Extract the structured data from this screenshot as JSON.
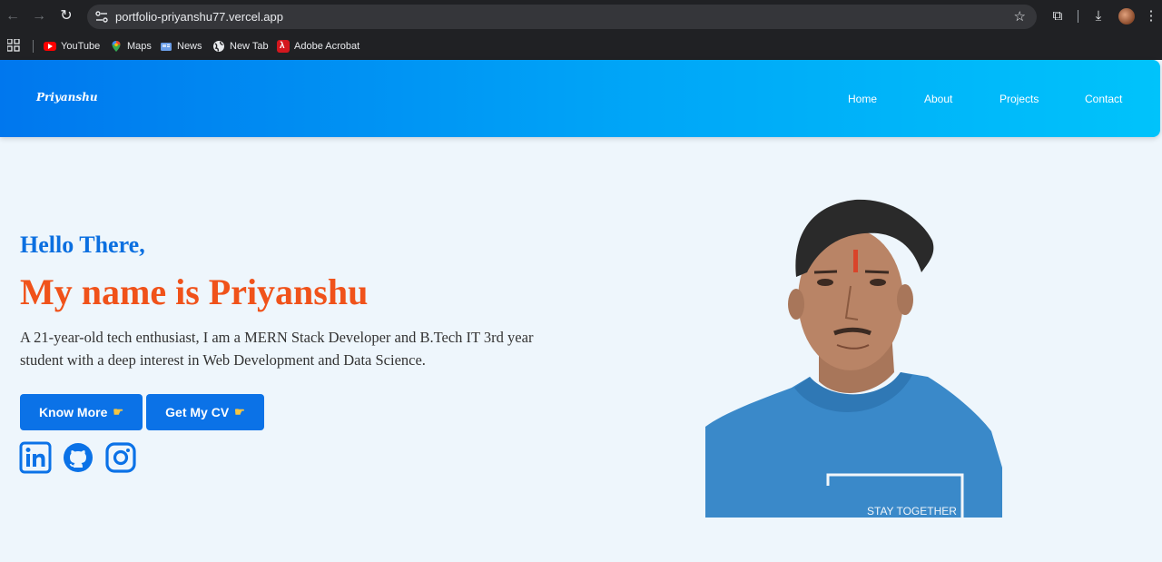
{
  "browser": {
    "url": "portfolio-priyanshu77.vercel.app",
    "bookmarks": [
      {
        "label": "YouTube",
        "icon": "youtube-icon"
      },
      {
        "label": "Maps",
        "icon": "maps-icon"
      },
      {
        "label": "News",
        "icon": "news-icon"
      },
      {
        "label": "New Tab",
        "icon": "globe-icon"
      },
      {
        "label": "Adobe Acrobat",
        "icon": "acrobat-icon"
      }
    ]
  },
  "navbar": {
    "brand": "Priyanshu",
    "links": [
      "Home",
      "About",
      "Projects",
      "Contact"
    ]
  },
  "hero": {
    "greeting": "Hello There,",
    "headline": "My name is Priyanshu",
    "description": "A 21-year-old tech enthusiast, I am a MERN Stack Developer and B.Tech IT 3rd year student with a deep interest in Web Development and Data Science.",
    "buttons": [
      {
        "label": "Know More",
        "icon": "pointing-hand-icon"
      },
      {
        "label": "Get My CV",
        "icon": "pointing-hand-icon"
      }
    ],
    "socials": [
      "linkedin-icon",
      "github-icon",
      "instagram-icon"
    ],
    "photo_text": "STAY TOGETHER"
  },
  "colors": {
    "accent": "#0b72e7",
    "headline": "#f0521a",
    "greeting": "#0b6fe0",
    "background": "#eef6fc"
  }
}
